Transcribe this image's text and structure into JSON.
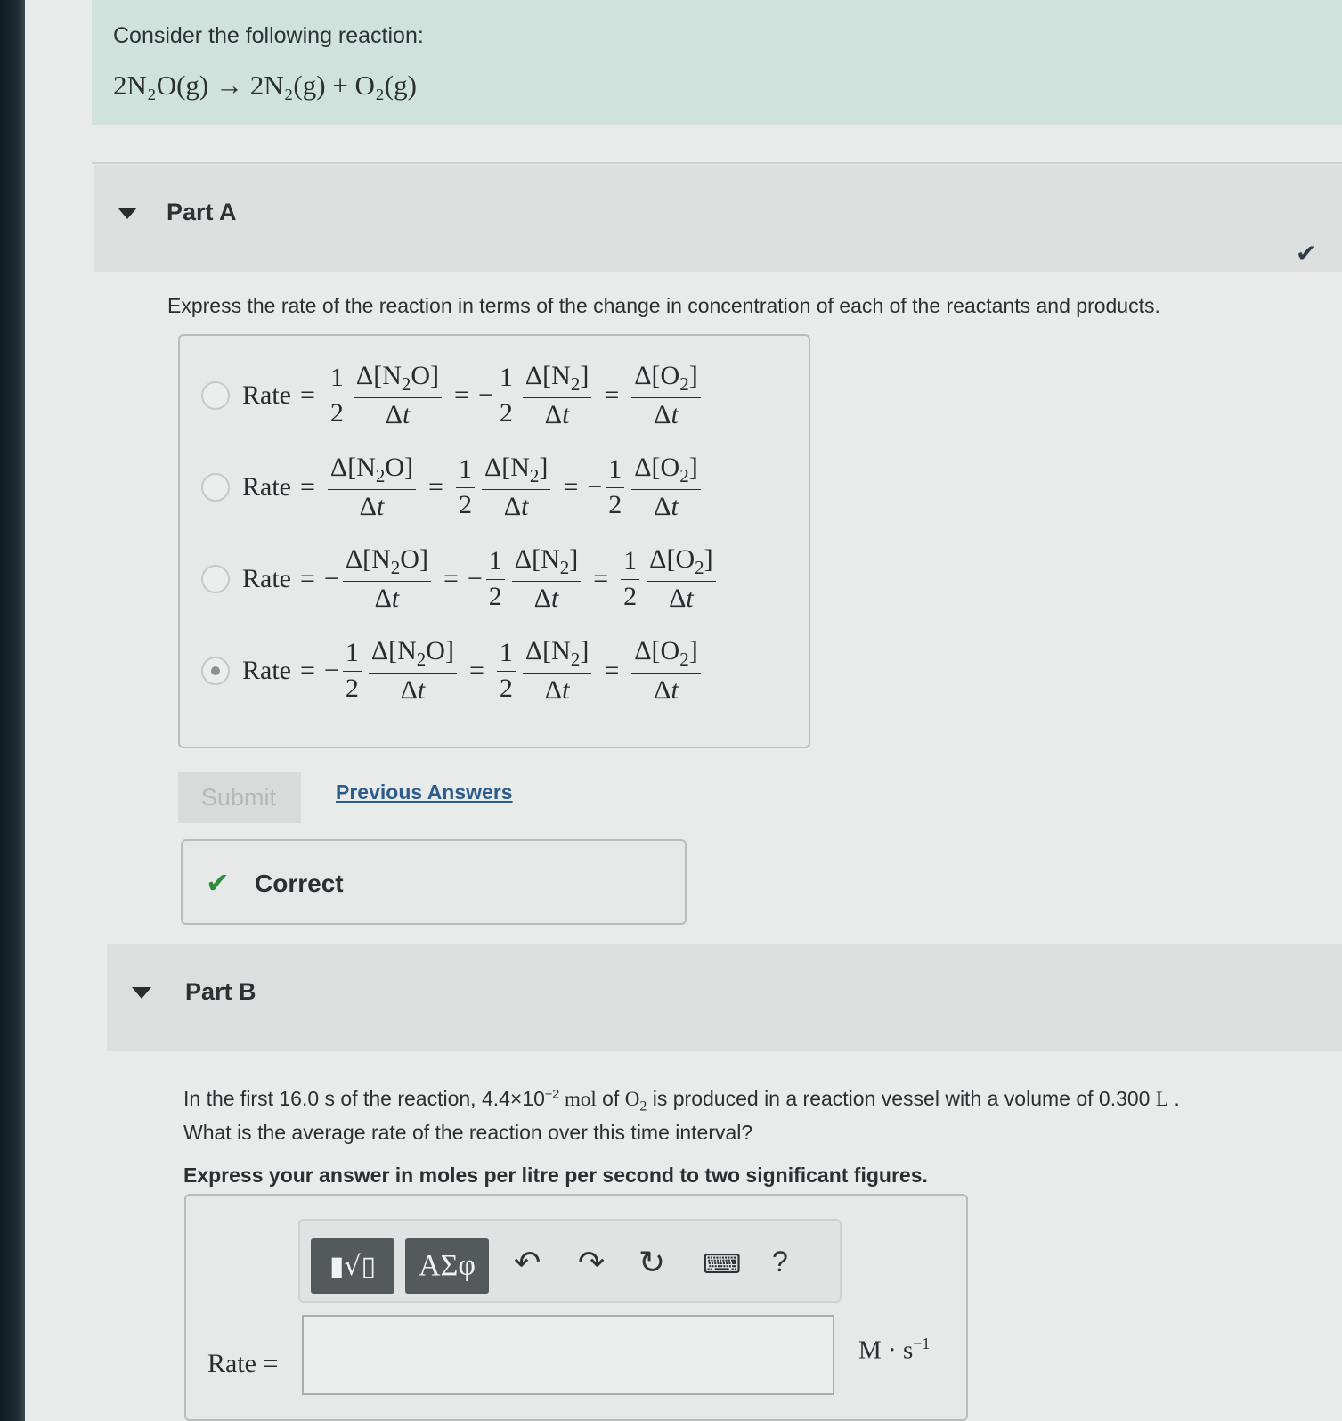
{
  "intro": {
    "prompt": "Consider the following reaction:",
    "equation": "2N₂O(g) → 2N₂(g) + O₂(g)"
  },
  "part_a": {
    "title": "Part A",
    "question": "Express the rate of the reaction in terms of the change in concentration of each of the reactants and products.",
    "selected_option": 4,
    "submit_label": "Submit",
    "previous_answers_label": "Previous Answers",
    "feedback": "Correct"
  },
  "part_b": {
    "title": "Part B",
    "question_pre": "In the first 16.0 s of the reaction, 4.4×10",
    "exponent": "−2",
    "question_mol": " mol",
    "question_of": " of ",
    "question_post": " is produced in a reaction vessel with a volume of 0.300 ",
    "volume_unit": "L",
    "question_line2": "What is the average rate of the reaction over this time interval?",
    "instruction": "Express your answer in moles per litre per second to two significant figures.",
    "answer_label": "Rate =",
    "answer_value": "",
    "unit_label": "M · s",
    "unit_exponent": "−1",
    "toolbar": {
      "greek_label": "ΑΣφ",
      "help_label": "?"
    }
  },
  "icons": {
    "caret": "caret-down-icon",
    "check": "check-icon",
    "undo": "undo-icon",
    "redo": "redo-icon",
    "reset": "reset-icon",
    "keyboard": "keyboard-icon",
    "templates": "templates-icon"
  },
  "colors": {
    "intro_bg": "#cfe2dc",
    "correct_green": "#2e8a3d",
    "link_blue": "#2d5c8a"
  }
}
